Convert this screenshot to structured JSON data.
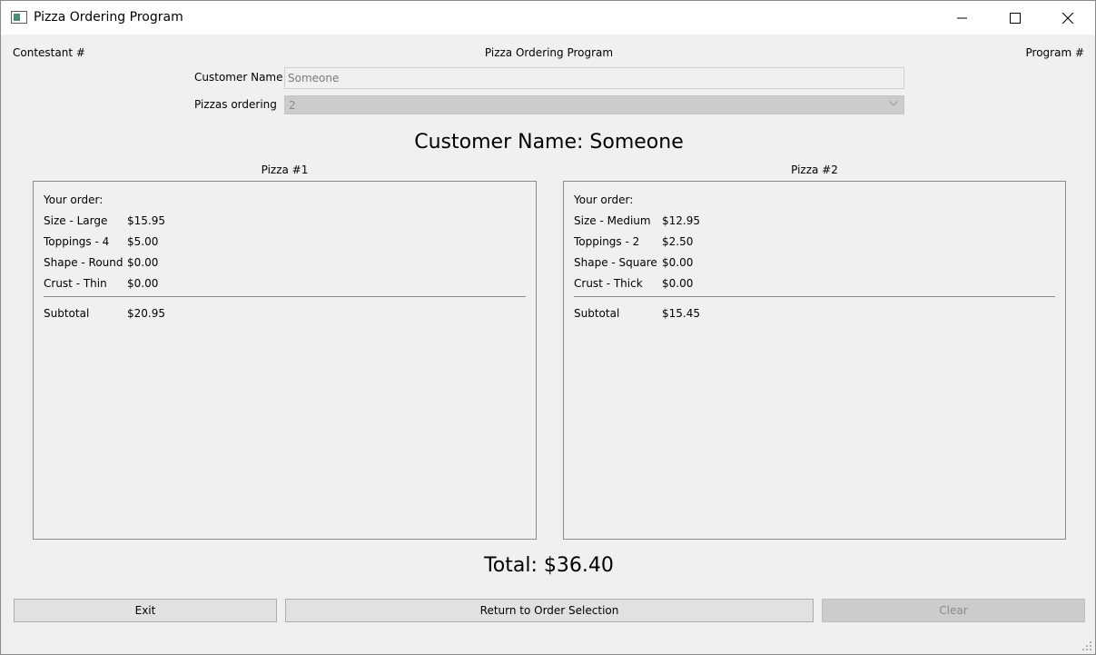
{
  "window": {
    "title": "Pizza Ordering Program"
  },
  "header": {
    "left": "Contestant #",
    "center": "Pizza Ordering Program",
    "right": "Program #"
  },
  "form": {
    "customer_name_label": "Customer Name",
    "customer_name_value": "Someone",
    "pizzas_label": "Pizzas ordering",
    "pizzas_value": "2"
  },
  "customer_heading": "Customer Name: Someone",
  "pizzas": [
    {
      "title": "Pizza #1",
      "your_order": "Your order:",
      "rows": [
        {
          "name": "Size - Large",
          "price": "$15.95"
        },
        {
          "name": "Toppings - 4",
          "price": "$5.00"
        },
        {
          "name": "Shape - Round",
          "price": "$0.00"
        },
        {
          "name": "Crust - Thin",
          "price": "$0.00"
        }
      ],
      "subtotal_label": "Subtotal",
      "subtotal": "$20.95"
    },
    {
      "title": "Pizza #2",
      "your_order": "Your order:",
      "rows": [
        {
          "name": "Size - Medium",
          "price": "$12.95"
        },
        {
          "name": "Toppings - 2",
          "price": "$2.50"
        },
        {
          "name": "Shape - Square",
          "price": "$0.00"
        },
        {
          "name": "Crust - Thick",
          "price": "$0.00"
        }
      ],
      "subtotal_label": "Subtotal",
      "subtotal": "$15.45"
    }
  ],
  "total": "Total: $36.40",
  "buttons": {
    "exit": "Exit",
    "return": "Return to Order Selection",
    "clear": "Clear"
  }
}
